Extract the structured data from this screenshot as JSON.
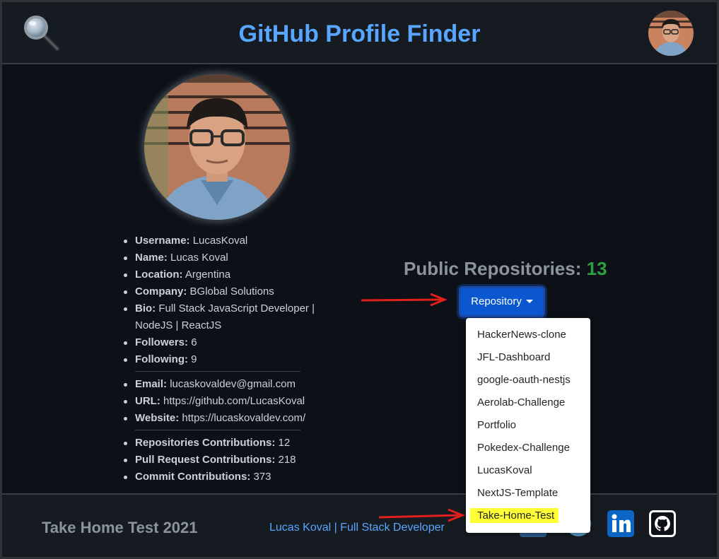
{
  "header": {
    "title": "GitHub Profile Finder",
    "search_icon": "magnifier-icon",
    "avatar_icon": "user-avatar"
  },
  "profile": {
    "fields": [
      {
        "label": "Username:",
        "value": "LucasKoval"
      },
      {
        "label": "Name:",
        "value": "Lucas Koval"
      },
      {
        "label": "Location:",
        "value": "Argentina"
      },
      {
        "label": "Company:",
        "value": "BGlobal Solutions"
      },
      {
        "label": "Bio:",
        "value": "Full Stack JavaScript Developer | NodeJS | ReactJS"
      },
      {
        "label": "Followers:",
        "value": "6"
      },
      {
        "label": "Following:",
        "value": "9"
      }
    ],
    "contact": [
      {
        "label": "Email:",
        "value": "lucaskovaldev@gmail.com"
      },
      {
        "label": "URL:",
        "value": "https://github.com/LucasKoval"
      },
      {
        "label": "Website:",
        "value": "https://lucaskovaldev.com/"
      }
    ],
    "contributions": [
      {
        "label": "Repositories Contributions:",
        "value": "12"
      },
      {
        "label": "Pull Request Contributions:",
        "value": "218"
      },
      {
        "label": "Commit Contributions:",
        "value": "373"
      }
    ]
  },
  "repos": {
    "title": "Public Repositories:",
    "count": "13",
    "button_label": "Repository",
    "items": [
      "HackerNews-clone",
      "JFL-Dashboard",
      "google-oauth-nestjs",
      "Aerolab-Challenge",
      "Portfolio",
      "Pokedex-Challenge",
      "LucasKoval",
      "NextJS-Template",
      "Take-Home-Test"
    ],
    "highlighted": "Take-Home-Test"
  },
  "footer": {
    "left": "Take Home Test 2021",
    "credit": "Lucas Koval | Full Stack Developer",
    "social": [
      "linkedin-icon",
      "github-icon"
    ]
  },
  "colors": {
    "accent": "#58a6ff",
    "count": "#2ea043",
    "button": "#0b57d0",
    "highlight": "#ffff33",
    "arrow": "#e0201a"
  }
}
